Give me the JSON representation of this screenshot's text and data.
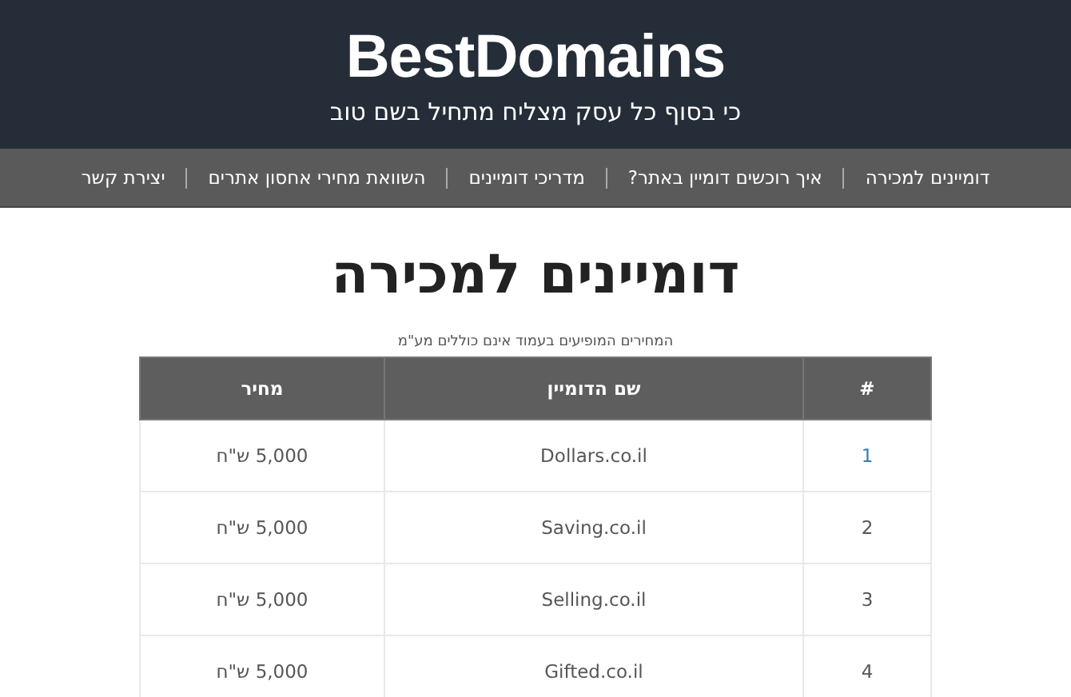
{
  "header": {
    "logo": "BestDomains",
    "tagline": "כי בסוף כל עסק מצליח מתחיל בשם טוב"
  },
  "nav": [
    {
      "label": "דומיינים למכירה"
    },
    {
      "label": "איך רוכשים דומיין באתר?"
    },
    {
      "label": "מדריכי דומיינים"
    },
    {
      "label": "השוואת מחירי אחסון אתרים"
    },
    {
      "label": "יצירת קשר"
    }
  ],
  "page_title": "דומיינים למכירה",
  "note": "המחירים המופיעים בעמוד אינם כוללים מע\"מ",
  "table": {
    "columns": [
      "#",
      "שם הדומיין",
      "מחיר"
    ],
    "rows": [
      {
        "number": "1",
        "domain": "Dollars.co.il",
        "price": "5,000 ש\"ח",
        "link": true
      },
      {
        "number": "2",
        "domain": "Saving.co.il",
        "price": "5,000 ש\"ח",
        "link": false
      },
      {
        "number": "3",
        "domain": "Selling.co.il",
        "price": "5,000 ש\"ח",
        "link": false
      },
      {
        "number": "4",
        "domain": "Gifted.co.il",
        "price": "5,000 ש\"ח",
        "link": false
      }
    ]
  }
}
